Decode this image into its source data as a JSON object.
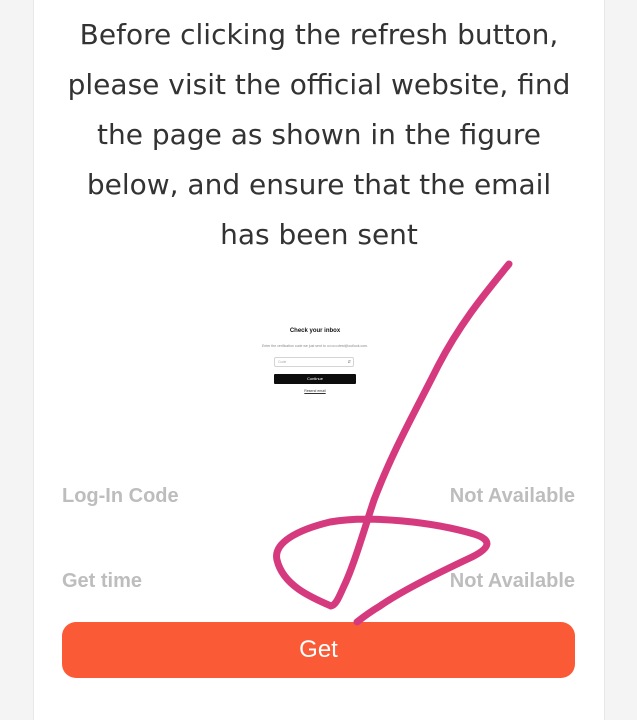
{
  "instruction": "Before clicking the refresh button, please visit the official website, find the page as shown in the figure below, and ensure that the email has been sent",
  "figure": {
    "title": "Check your inbox",
    "subtitle": "Enter the verification code we just sent to ••••••••••test@outlook.com.",
    "code_placeholder": "Code",
    "continue_label": "Continue",
    "resend_label": "Resend email"
  },
  "rows": [
    {
      "label": "Log-In Code",
      "value": "Not Available"
    },
    {
      "label": "Get time",
      "value": "Not Available"
    }
  ],
  "get_button_label": "Get",
  "colors": {
    "accent": "#fb5a36",
    "annotation_stroke": "#d63a7e",
    "muted_text": "#bdbdbd"
  }
}
